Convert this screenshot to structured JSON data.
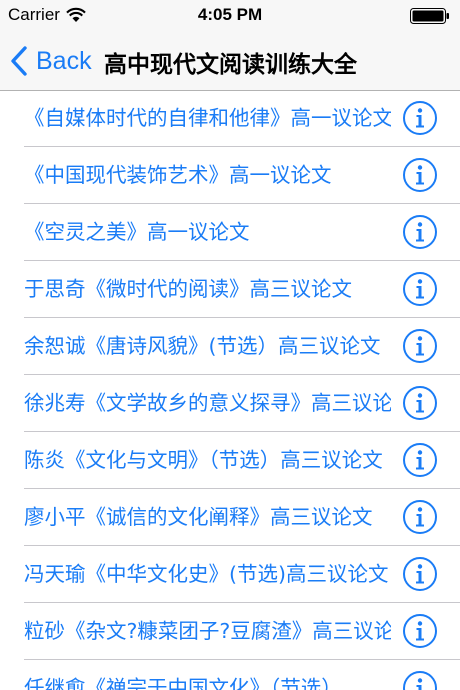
{
  "status_bar": {
    "carrier": "Carrier",
    "time": "4:05 PM",
    "wifi_icon": "wifi-icon",
    "battery_icon": "battery-icon"
  },
  "nav": {
    "back_label": "Back",
    "back_icon": "chevron-left-icon",
    "title": "高中现代文阅读训练大全"
  },
  "accent_color": "#1a7cf6",
  "list": {
    "info_icon": "info-icon",
    "items": [
      {
        "label": "《自媒体时代的自律和他律》高一议论文"
      },
      {
        "label": "《中国现代装饰艺术》高一议论文"
      },
      {
        "label": "《空灵之美》高一议论文"
      },
      {
        "label": "于思奇《微时代的阅读》高三议论文"
      },
      {
        "label": "余恕诚《唐诗风貌》(节选）高三议论文"
      },
      {
        "label": "徐兆寿《文学故乡的意义探寻》高三议论文"
      },
      {
        "label": "陈炎《文化与文明》（节选）高三议论文"
      },
      {
        "label": "廖小平《诚信的文化阐释》高三议论文"
      },
      {
        "label": "冯天瑜《中华文化史》(节选)高三议论文"
      },
      {
        "label": "粒砂《杂文?糠菜团子?豆腐渣》高三议论文"
      },
      {
        "label": "任继愈《禅宗于中国文化》（节选）"
      }
    ]
  }
}
